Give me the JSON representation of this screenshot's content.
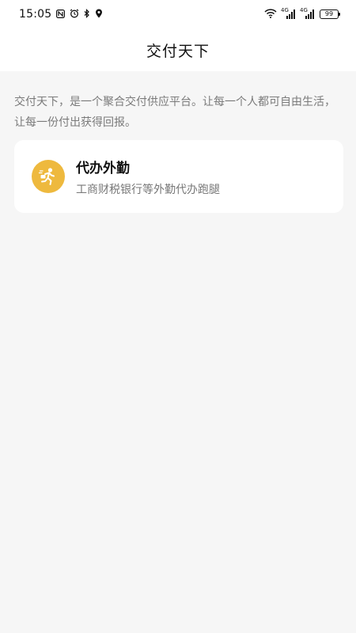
{
  "status_bar": {
    "time": "15:05",
    "left_icons": [
      "nfc-icon",
      "alarm-icon",
      "bluetooth-icon",
      "location-icon"
    ],
    "battery": "99",
    "signal1_label": "4G",
    "signal2_label": "4G"
  },
  "nav": {
    "title": "交付天下"
  },
  "intro": {
    "text": "交付天下，是一个聚合交付供应平台。让每一个人都可自由生活，让每一份付出获得回报。"
  },
  "services": [
    {
      "title": "代办外勤",
      "description": "工商财税银行等外勤代办跑腿",
      "icon": "runner-icon",
      "icon_color": "#eeb93e"
    }
  ]
}
